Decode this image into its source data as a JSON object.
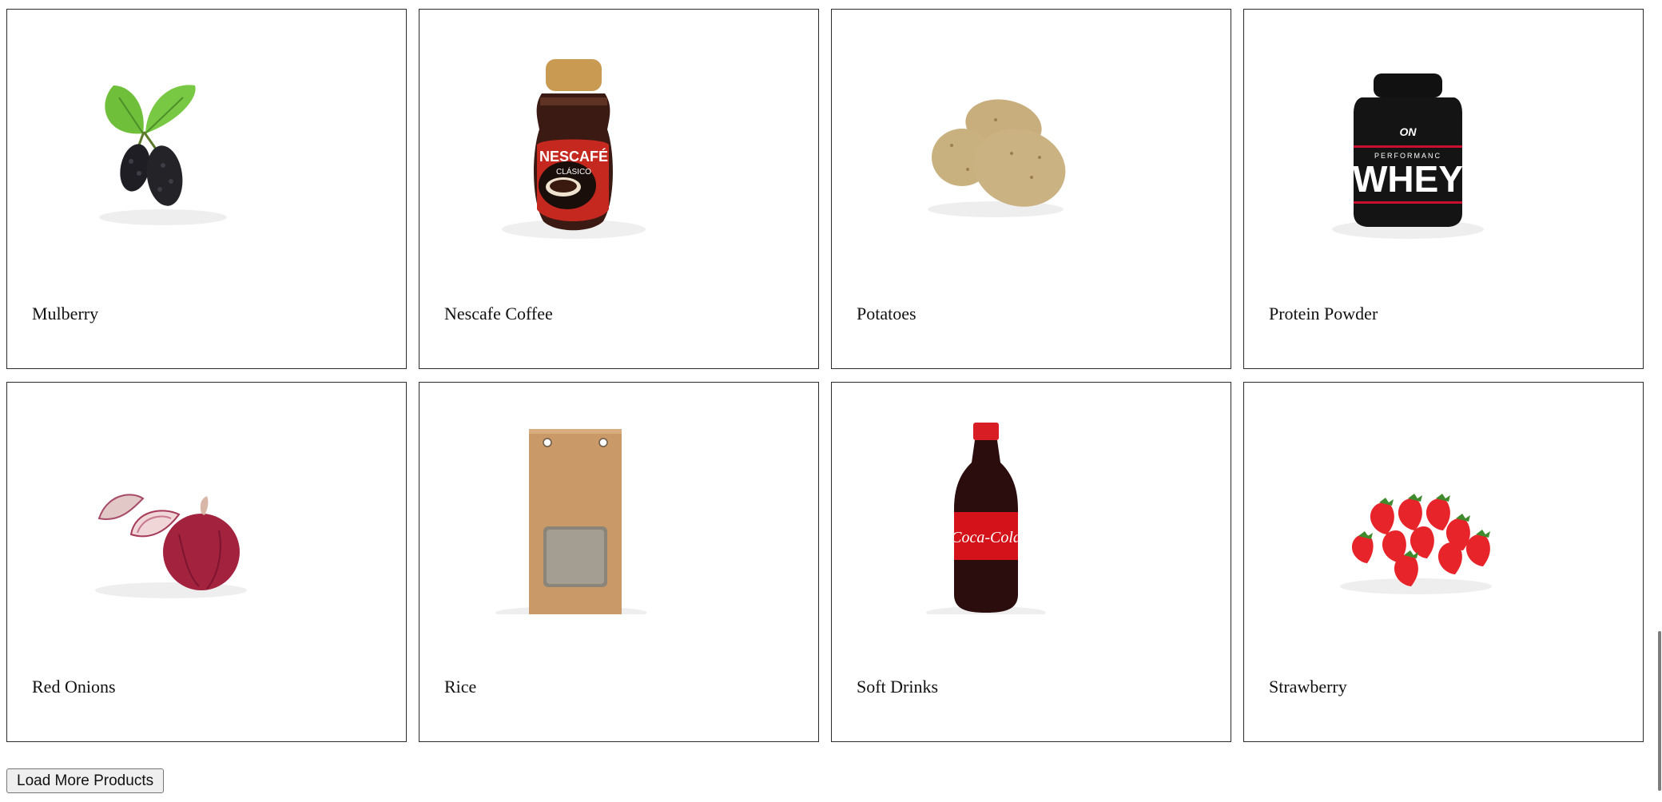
{
  "products": [
    {
      "name": "Mulberry",
      "icon": "mulberry-icon"
    },
    {
      "name": "Nescafe Coffee",
      "icon": "coffee-jar-icon"
    },
    {
      "name": "Potatoes",
      "icon": "potatoes-icon"
    },
    {
      "name": "Protein Powder",
      "icon": "protein-tub-icon"
    },
    {
      "name": "Red Onions",
      "icon": "red-onion-icon"
    },
    {
      "name": "Rice",
      "icon": "rice-bag-icon"
    },
    {
      "name": "Soft Drinks",
      "icon": "soda-bottle-icon"
    },
    {
      "name": "Strawberry",
      "icon": "strawberry-icon"
    }
  ],
  "labels": {
    "nescafe_brand": "NESCAFÉ",
    "nescafe_variant": "CLÁSICO",
    "protein_logo": "ON",
    "protein_line": "PERFORMANC",
    "protein_brand": "WHEY",
    "soda_brand": "Coca-Cola"
  },
  "load_more": {
    "label": "Load More Products"
  },
  "colors": {
    "card_border": "#2b2b2b",
    "button_bg": "#efefef",
    "button_border": "#767676"
  }
}
